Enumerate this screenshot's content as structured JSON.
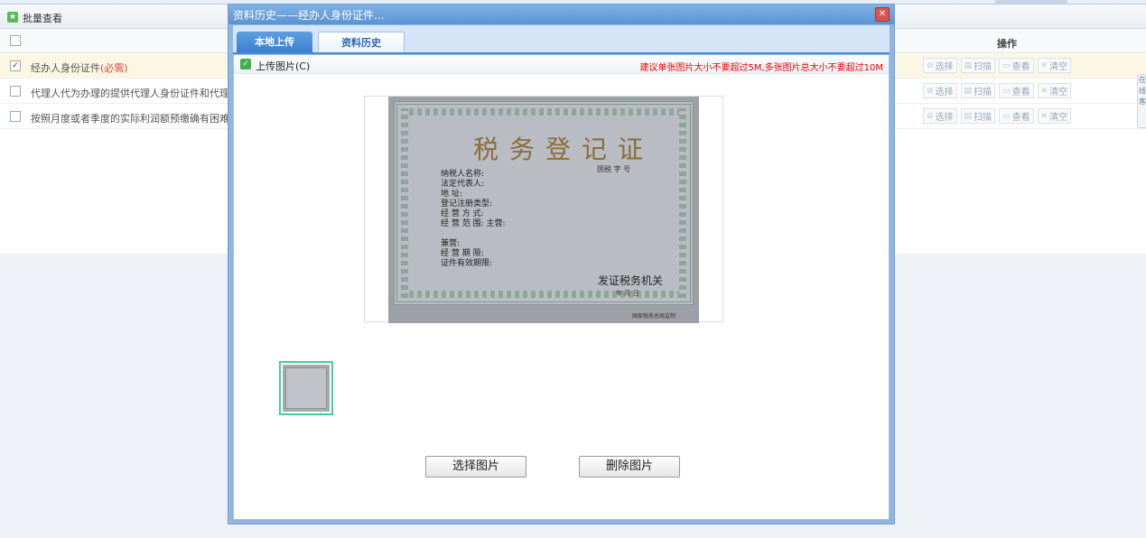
{
  "page": {
    "batch_view_label": "批量查看",
    "columns": {
      "operation": "操作"
    },
    "rows": [
      {
        "checked": true,
        "text": "经办人身份证件",
        "required": "(必需)",
        "check_mark": "✓"
      },
      {
        "checked": false,
        "text": "代理人代为办理的提供代理人身份证件和代理委",
        "required": "",
        "check_mark": ""
      },
      {
        "checked": false,
        "text": "按照月度或者季度的实际利润额预缴确有困难的",
        "required": "",
        "check_mark": ""
      }
    ],
    "row_actions": {
      "select": "选择",
      "scan": "扫描",
      "view": "查看",
      "clear": "清空"
    },
    "side_handle": "在线客"
  },
  "dialog": {
    "title": "资料历史——经办人身份证件...",
    "close_glyph": "✕",
    "tabs": [
      {
        "label": "本地上传",
        "active": true
      },
      {
        "label": "资料历史",
        "active": false
      }
    ],
    "upload": {
      "label": "上传图片(C)",
      "hint": "建议单张图片大小不要超过5M,多张图片总大小不要超过10M"
    },
    "certificate": {
      "title": "税务登记证",
      "number_line": "国税  字            号",
      "fields": [
        "纳税人名称:",
        "法定代表人:",
        "地      址:",
        "登记注册类型:",
        "经 营 方 式:",
        "经 营 范 围: 主营:",
        "",
        "            兼营:",
        "经 营 期 限:",
        "证件有效期限:"
      ],
      "issuer": "发证税务机关",
      "date": "年      月      日",
      "print_footer": "国家税务总局监制"
    },
    "buttons": {
      "select_image": "选择图片",
      "delete_image": "删除图片"
    }
  },
  "colors": {
    "title_bar": "#5b93d3",
    "active_tab": "#3a7fcf",
    "hint_red": "#e00000",
    "thumb_border": "#48c9a0"
  }
}
